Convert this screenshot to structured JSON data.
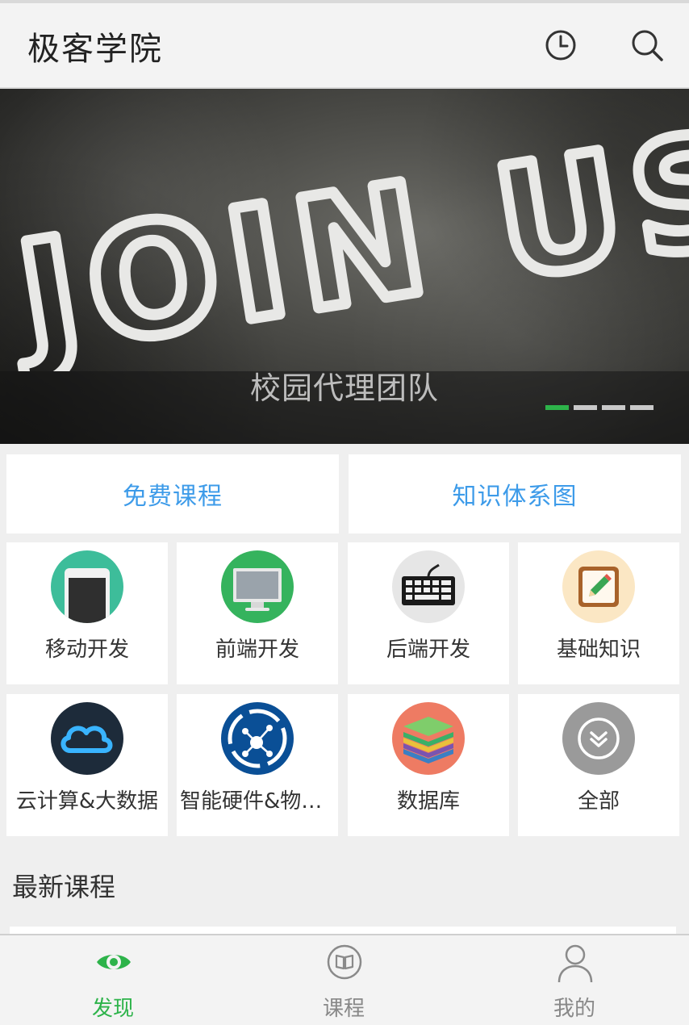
{
  "header": {
    "title": "极客学院",
    "history_icon": "clock-icon",
    "search_icon": "search-icon"
  },
  "banner": {
    "image_text": "JOIN US!",
    "caption": "校园代理团队",
    "slides_total": 4,
    "active_slide": 1
  },
  "quick_links": [
    {
      "label": "免费课程"
    },
    {
      "label": "知识体系图"
    }
  ],
  "categories": [
    {
      "label": "移动开发",
      "icon": "phone-icon",
      "color": "#3dbd9a"
    },
    {
      "label": "前端开发",
      "icon": "monitor-icon",
      "color": "#35b35d"
    },
    {
      "label": "后端开发",
      "icon": "keyboard-icon",
      "color": "#e6e6e6"
    },
    {
      "label": "基础知识",
      "icon": "notebook-pencil-icon",
      "color": "#fbe7c4"
    },
    {
      "label": "云计算&大数据",
      "icon": "cloud-icon",
      "color": "#1d2b3a"
    },
    {
      "label": "智能硬件&物联…",
      "icon": "iot-network-icon",
      "color": "#0a4f96"
    },
    {
      "label": "数据库",
      "icon": "stacked-layers-icon",
      "color": "#ee7b63"
    },
    {
      "label": "全部",
      "icon": "chevron-double-down-icon",
      "color": "#9a9a9a"
    }
  ],
  "latest": {
    "title": "最新课程"
  },
  "tabbar": [
    {
      "label": "发现",
      "icon": "eye-icon",
      "active": true
    },
    {
      "label": "课程",
      "icon": "book-icon",
      "active": false
    },
    {
      "label": "我的",
      "icon": "person-icon",
      "active": false
    }
  ],
  "colors": {
    "accent_green": "#2db34a",
    "link_blue": "#3d9be9",
    "text_dark": "#333333",
    "tab_inactive": "#888888"
  }
}
